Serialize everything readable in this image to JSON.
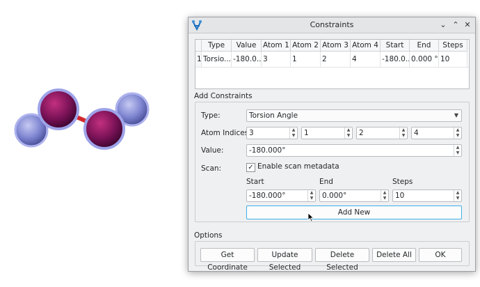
{
  "dialog": {
    "title": "Constraints",
    "controls": {
      "minimize": "⌄",
      "maximize": "⌃",
      "close": "✕"
    }
  },
  "table": {
    "headers": [
      "Type",
      "Value",
      "Atom 1",
      "Atom 2",
      "Atom 3",
      "Atom 4",
      "Start",
      "End",
      "Steps"
    ],
    "rows": [
      {
        "index": "1",
        "cells": [
          "Torsio...",
          "-180.0...",
          "3",
          "1",
          "2",
          "4",
          "-180.0...",
          "0.000 °",
          "10"
        ]
      }
    ]
  },
  "add_constraints": {
    "section_label": "Add Constraints",
    "type_label": "Type:",
    "type_value": "Torsion Angle",
    "atom_indices_label": "Atom Indices:",
    "atom_indices": [
      "3",
      "1",
      "2",
      "4"
    ],
    "value_label": "Value:",
    "value": "-180.000°",
    "scan_label": "Scan:",
    "scan_checkbox_label": "Enable scan metadata",
    "scan_checked": true,
    "start_label": "Start",
    "start_value": "-180.000°",
    "end_label": "End",
    "end_value": "0.000°",
    "steps_label": "Steps",
    "steps_value": "10",
    "add_new_label": "Add New"
  },
  "options": {
    "section_label": "Options",
    "buttons": [
      "Get Coordinate",
      "Update Selected",
      "Delete Selected",
      "Delete All",
      "OK"
    ]
  },
  "molecule": {
    "atom_colors": {
      "purple": "#7a1257",
      "blue": "#7f86d1",
      "bond": "#d4282b"
    }
  }
}
